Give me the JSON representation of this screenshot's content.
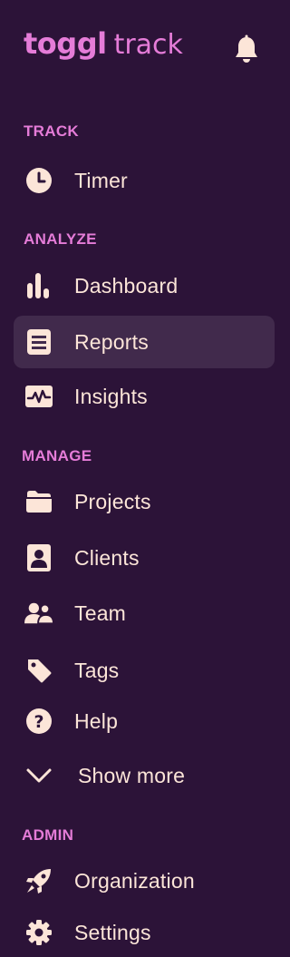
{
  "brand": {
    "logo_main": "toggl",
    "logo_sub": "track",
    "accent_color": "#e57cd8",
    "text_color": "#fce5d8",
    "background_color": "#2c1338",
    "active_background_color": "#412a4c"
  },
  "notifications": {
    "icon": "bell-icon"
  },
  "sections": {
    "track": "TRACK",
    "analyze": "ANALYZE",
    "manage": "MANAGE",
    "admin": "ADMIN"
  },
  "nav": {
    "timer": {
      "label": "Timer",
      "icon": "clock-icon"
    },
    "dashboard": {
      "label": "Dashboard",
      "icon": "bar-chart-icon"
    },
    "reports": {
      "label": "Reports",
      "icon": "report-list-icon",
      "active": true
    },
    "insights": {
      "label": "Insights",
      "icon": "pulse-chart-icon"
    },
    "projects": {
      "label": "Projects",
      "icon": "folder-icon"
    },
    "clients": {
      "label": "Clients",
      "icon": "client-contact-icon"
    },
    "team": {
      "label": "Team",
      "icon": "team-people-icon"
    },
    "tags": {
      "label": "Tags",
      "icon": "tag-icon"
    },
    "help": {
      "label": "Help",
      "icon": "question-circle-icon"
    },
    "show_more": {
      "label": "Show more",
      "icon": "chevron-down-icon"
    },
    "organization": {
      "label": "Organization",
      "icon": "rocket-icon"
    },
    "settings": {
      "label": "Settings",
      "icon": "gear-icon"
    }
  }
}
